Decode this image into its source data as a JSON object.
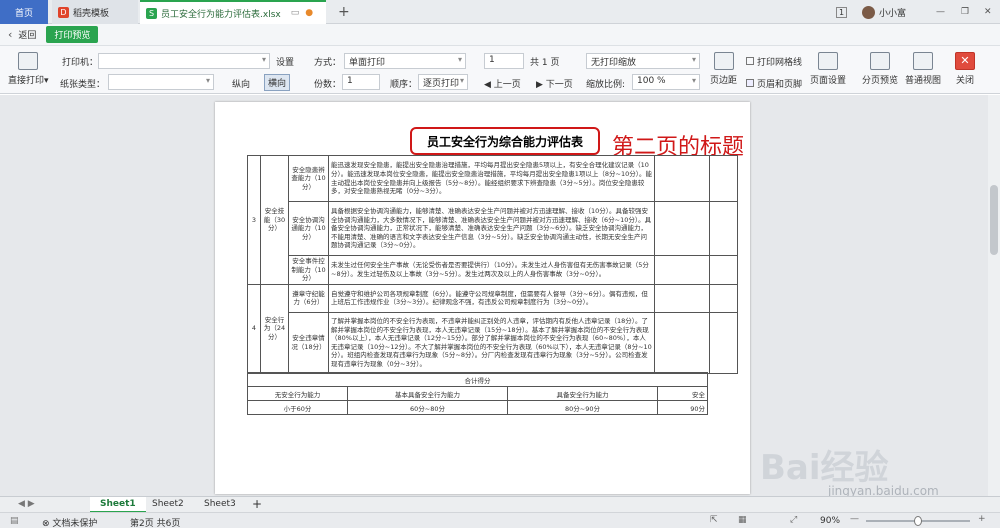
{
  "tabs": {
    "home": "首页",
    "template": "稻壳模板",
    "file": "员工安全行为能力评估表.xlsx",
    "page_num": "1",
    "user": "小小富"
  },
  "toolbar1": {
    "back": "返回",
    "mode": "打印预览"
  },
  "toolbar2": {
    "direct_print": "直接打印",
    "printer_label": "打印机：",
    "paper_label": "纸张类型：",
    "settings": "设置",
    "portrait": "纵向",
    "landscape": "横向",
    "method_label": "方式：",
    "method_value": "单面打印",
    "copies_label": "份数：",
    "copies_value": "1",
    "order_label": "顺序：",
    "order_value": "逐页打印",
    "page_value": "1",
    "page_total": "共 1 页",
    "prev_page": "上一页",
    "next_page": "下一页",
    "scale_value": "无打印缩放",
    "zoom_label": "缩放比例:",
    "zoom_value": "100 %",
    "print_grid": "打印网格线",
    "header_footer": "页眉和页脚",
    "margins": "页边距",
    "page_setup": "页面设置",
    "page_preview": "分页预览",
    "normal_view": "普通视图",
    "close": "关闭"
  },
  "sheet": {
    "title": "员工安全行为综合能力评估表",
    "annotation": "第二页的标题",
    "rows": [
      {
        "num": "3",
        "category": "安全技能（30分）",
        "item": "安全隐患辨查能力（10分）",
        "text": "能迅速发现安全隐患，能提出安全隐患治理措施，平均每月提出安全隐患5项以上，有安全合理化建议记录（10分）。能迅速发现本岗位安全隐患，能提出安全隐患治理措施，平均每月提出安全隐患1项以上（8分~10分）。能主动提出本岗位安全隐患并向上级报告（5分~8分）。能经组织要求下辨查隐患（3分~5分）。岗位安全隐患较多，对安全隐患熟视无睹（0分~3分）。"
      },
      {
        "num": "",
        "category": "",
        "item": "安全协调沟通能力（10分）",
        "text": "具备根据安全协调沟通能力，能够清楚、准确表达安全生产问题并被对方迅速理解、接收（10分）。具备较强安全协调沟通能力，大多数情况下，能够清楚、准确表达安全生产问题并被对方迅速理解、接收（6分~10分）。具备安全协调沟通能力，正常状况下，能够清楚、准确表达安全生产问题（3分~6分）。缺乏安全协调沟通能力，不能用清楚、准确的语言和文字表达安全生产信息（3分~5分）。缺乏安全协调沟通主动性，长期无安全生产问题协调沟通记录（3分~0分）。"
      },
      {
        "num": "",
        "category": "",
        "item": "安全事件控制能力（10分）",
        "text": "未发生过任何安全生产事故（无论受伤者是否要提供行）（10分）。未发生过人身伤害但有无伤害事故记录（5分~8分）。发生过轻伤及以上事故（3分~5分）。发生过两次及以上的人身伤害事故（3分~0分）。"
      },
      {
        "num": "4",
        "category": "安全行为（24分）",
        "item": "遵章守纪能力（6分）",
        "text": "自觉遵守和维护公司各项规章制度（6分）。能遵守公司规章制度，但需要有人督导（3分~6分）。偶有违规，但上班后工作违规作业（3分~3分）。纪律观念不强，有违反公司规章制度行为（3分~0分）。"
      },
      {
        "num": "",
        "category": "",
        "item": "安全违章情况（18分）",
        "text": "了解并掌握本岗位的不安全行为表现，不违章并能纠正别处的人违章，评估期内有反他人违章记录（18分）。了解并掌握本岗位的不安全行为表现，本人无违章记录（15分~18分）。基本了解并掌握本岗位的不安全行为表现（80%以上），本人无违章记录（12分~15分）。部分了解并掌握本岗位的不安全行为表现（60~80%），本人无违章记录（10分~12分）。不大了解并掌握本岗位的不安全行为表现（60%以下），本人无违章记录（8分~10分）。班组内检查发现有违章行为现象（5分~8分）。分厂内检查发现有违章行为现象（3分~5分）。公司检查发现有违章行为现象（0分~3分）。"
      }
    ],
    "total_label": "合计得分",
    "levels": [
      "无安全行为能力",
      "基本具备安全行为能力",
      "具备安全行为能力",
      "安全"
    ],
    "scores": [
      "小于60分",
      "60分~80分",
      "80分~90分",
      "90分"
    ]
  },
  "sheet_tabs": [
    "Sheet1",
    "Sheet2",
    "Sheet3"
  ],
  "status": {
    "protect": "文档未保护",
    "page": "第2页 共6页",
    "zoom": "90%"
  },
  "watermark": {
    "text": "Bai经验",
    "url": "jingyan.baidu.com"
  }
}
